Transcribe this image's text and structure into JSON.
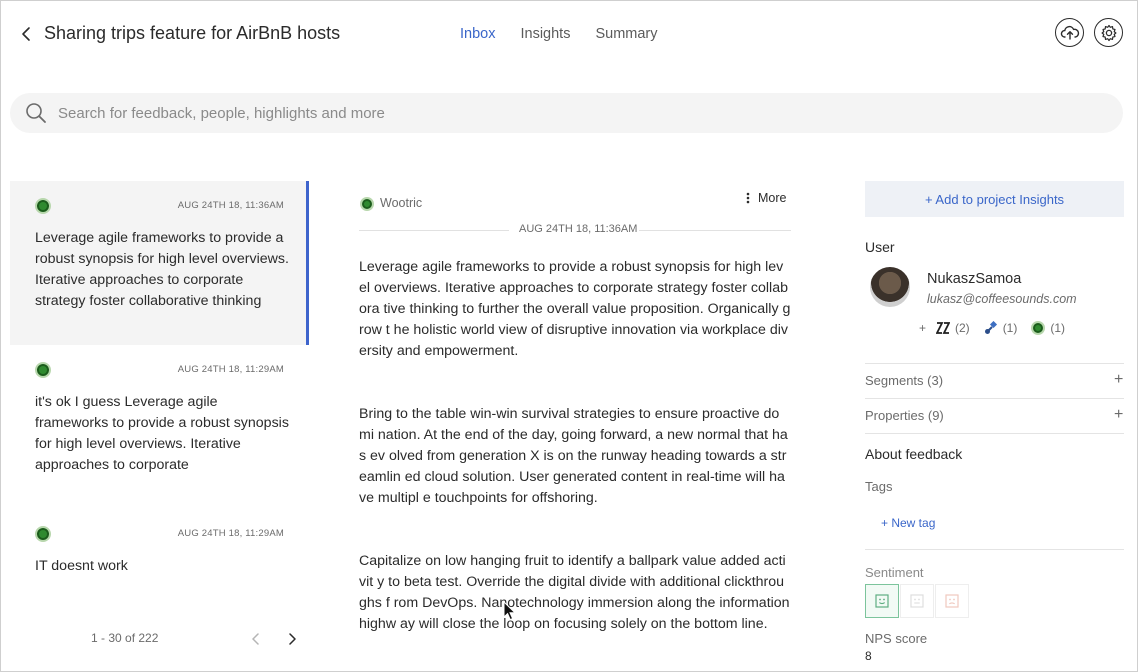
{
  "header": {
    "title": "Sharing trips feature for AirBnB hosts",
    "tabs": [
      {
        "label": "Inbox",
        "active": true
      },
      {
        "label": "Insights",
        "active": false
      },
      {
        "label": "Summary",
        "active": false
      }
    ]
  },
  "search": {
    "placeholder": "Search for feedback, people, highlights and more"
  },
  "feedback_list": {
    "items": [
      {
        "time": "AUG 24TH 18, 11:36AM",
        "text": "Leverage agile frameworks to provide a robust synopsis for high level overviews. Iterative approaches to corporate strategy foster collaborative thinking",
        "selected": true
      },
      {
        "time": "AUG 24TH 18, 11:29AM",
        "text": "it's ok I guess Leverage agile frameworks to provide a robust synopsis for high level overviews. Iterative approaches to corporate",
        "selected": false
      },
      {
        "time": "AUG 24TH 18, 11:29AM",
        "text": "IT doesnt work",
        "selected": false
      }
    ],
    "pagination": "1 - 30 of 222"
  },
  "detail": {
    "source": "Wootric",
    "more_label": "More",
    "date": "AUG 24TH 18, 11:36AM",
    "paragraphs": [
      "Leverage agile frameworks to provide a robust synopsis for high level  overviews. Iterative approaches to corporate strategy foster collabora tive thinking to further the overall value proposition. Organically grow t he holistic world view of disruptive innovation via workplace diversity  and empowerment.",
      "Bring to the table win-win survival strategies to ensure proactive domi nation. At the end of the day, going forward, a new normal that has ev olved from generation X is on the runway heading towards a streamlin ed cloud solution. User generated content in real-time will have multipl e touchpoints for offshoring.",
      "Capitalize on low hanging fruit to identify a ballpark value added activit y to beta test. Override the digital divide with additional clickthroughs f rom DevOps. Nanotechnology immersion along the information highw ay will close the loop on focusing solely on the bottom line."
    ]
  },
  "sidebar": {
    "add_insights": "+ Add to project Insights",
    "user_label": "User",
    "user": {
      "name": "NukaszSamoa",
      "email": "lukasz@coffeesounds.com"
    },
    "integrations": {
      "plus": "+",
      "zendesk_count": "(2)",
      "intercom_count": "(1)",
      "wootric_count": "(1)"
    },
    "segments": "Segments (3)",
    "properties": "Properties (9)",
    "about_feedback": "About feedback",
    "tags_label": "Tags",
    "new_tag": "+ New tag",
    "sentiment_label": "Sentiment",
    "nps_label": "NPS score",
    "nps_value": "8"
  },
  "colors": {
    "accent": "#3a66c9",
    "selected_bar": "#3e64cc",
    "positive": "#7cc49c"
  }
}
